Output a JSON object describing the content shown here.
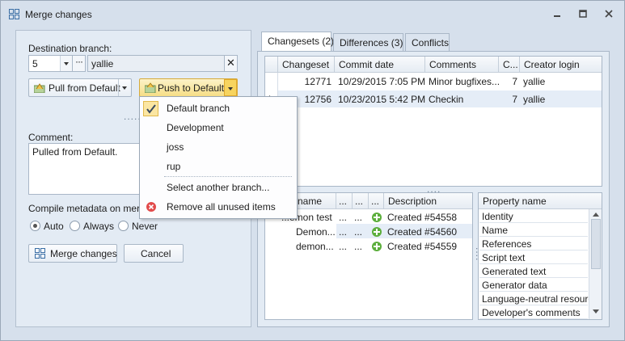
{
  "window": {
    "title": "Merge changes"
  },
  "left": {
    "destination_label": "Destination branch:",
    "branch_number": "5",
    "branch_name": "yallie",
    "pull_button": "Pull from Default",
    "push_button": "Push to Default",
    "comment_label": "Comment:",
    "comment_text": "Pulled from Default.",
    "compile_label": "Compile metadata on merge",
    "radio_auto": "Auto",
    "radio_always": "Always",
    "radio_never": "Never",
    "merge_button": "Merge changes",
    "cancel_button": "Cancel"
  },
  "menu": {
    "items": [
      {
        "label": "Default branch",
        "checked": true
      },
      {
        "label": "Development"
      },
      {
        "label": "joss"
      },
      {
        "label": "rup"
      },
      {
        "label": "Select another branch..."
      },
      {
        "label": "Remove all unused items",
        "icon": "remove-icon"
      }
    ]
  },
  "tabs": [
    {
      "label": "Changesets (2)",
      "active": true
    },
    {
      "label": "Differences (3)"
    },
    {
      "label": "Conflicts"
    }
  ],
  "changesets": {
    "columns": [
      "Changeset",
      "Commit date",
      "Comments",
      "C...",
      "Creator login"
    ],
    "rows": [
      {
        "changeset": "12771",
        "date": "10/29/2015 7:05 PM",
        "comments": "Minor bugfixes...",
        "count": "7",
        "login": "yallie"
      },
      {
        "changeset": "12756",
        "date": "10/23/2015 5:42 PM",
        "comments": "Checkin",
        "count": "7",
        "login": "yallie"
      }
    ]
  },
  "items_grid": {
    "columns": [
      "name",
      "...",
      "...",
      "...",
      "Description"
    ],
    "rows": [
      {
        "name": "...emon test",
        "c1": "...",
        "c2": "...",
        "description": "Created #54558"
      },
      {
        "name": "Demon...",
        "c1": "...",
        "c2": "...",
        "description": "Created #54560"
      },
      {
        "name": "demon...",
        "c1": "...",
        "c2": "...",
        "description": "Created #54559"
      }
    ]
  },
  "properties": {
    "header": "Property name",
    "items": [
      "Identity",
      "Name",
      "References",
      "Script text",
      "Generated text",
      "Generator data",
      "Language-neutral resource",
      "Developer's comments"
    ]
  }
}
